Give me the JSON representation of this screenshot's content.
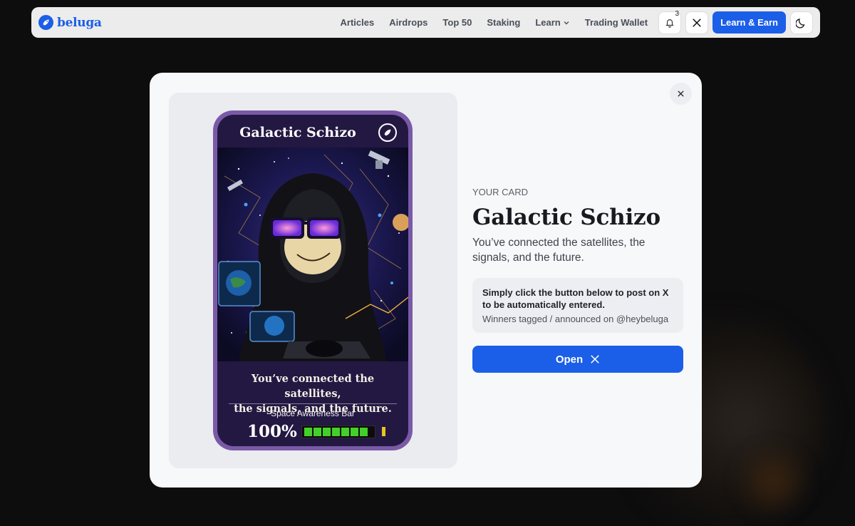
{
  "brand": {
    "name": "beluga",
    "color": "#1b5ee8"
  },
  "nav": {
    "links": [
      "Articles",
      "Airdrops",
      "Top 50",
      "Staking",
      "Learn",
      "Trading Wallet"
    ],
    "notification_count": "3",
    "cta_label": "Learn & Earn",
    "icons": [
      "bell-icon",
      "x-logo-icon",
      "moon-icon",
      "chevron-down-icon"
    ]
  },
  "modal": {
    "kicker": "YOUR CARD",
    "title": "Galactic Schizo",
    "subtitle": "You’ve connected the satellites, the signals, and the future.",
    "info_strong": "Simply click the button below to post on X to be automatically entered.",
    "info_note": "Winners tagged / announced on @heybeluga",
    "open_label": "Open",
    "close_icon": "close-icon"
  },
  "card": {
    "title": "Galactic Schizo",
    "quote_line1": "You’ve connected the satellites,",
    "quote_line2": "the signals, and the future.",
    "bar_label": "Space Awareness Bar",
    "percent": "100%",
    "bar_level": 1.0,
    "frame_color": "#7a5aa6"
  }
}
